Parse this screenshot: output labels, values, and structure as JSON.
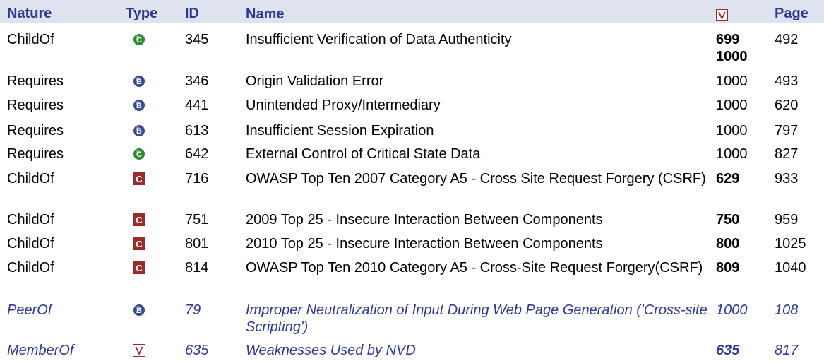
{
  "header": {
    "nature": "Nature",
    "type": "Type",
    "id": "ID",
    "name": "Name",
    "view_icon": "view-icon",
    "page": "Page"
  },
  "rows": [
    {
      "nature": "ChildOf",
      "type_icon": "compound-icon",
      "id": "345",
      "name": "Insufficient Verification of Data Authenticity",
      "view": "699",
      "view2": "1000",
      "page": "492",
      "view_bold": true
    },
    {
      "nature": "Requires",
      "type_icon": "base-icon",
      "id": "346",
      "name": "Origin Validation Error",
      "view": "1000",
      "view2": "",
      "page": "493",
      "view_bold": false
    },
    {
      "nature": "Requires",
      "type_icon": "base-icon",
      "id": "441",
      "name": "Unintended Proxy/Intermediary",
      "view": "1000",
      "view2": "",
      "page": "620",
      "view_bold": false
    },
    {
      "nature": "Requires",
      "type_icon": "base-icon",
      "id": "613",
      "name": "Insufficient Session Expiration",
      "view": "1000",
      "view2": "",
      "page": "797",
      "view_bold": false
    },
    {
      "nature": "Requires",
      "type_icon": "compound-icon",
      "id": "642",
      "name": "External Control of Critical State Data",
      "view": "1000",
      "view2": "",
      "page": "827",
      "view_bold": false
    },
    {
      "nature": "ChildOf",
      "type_icon": "category-icon",
      "id": "716",
      "name": "OWASP Top Ten 2007 Category A5 - Cross Site Request Forgery (CSRF)",
      "view": "629",
      "view2": "",
      "page": "933",
      "view_bold": true
    },
    {
      "nature": "ChildOf",
      "type_icon": "category-icon",
      "id": "751",
      "name": "2009 Top 25 - Insecure Interaction Between Components",
      "view": "750",
      "view2": "",
      "page": "959",
      "view_bold": true
    },
    {
      "nature": "ChildOf",
      "type_icon": "category-icon",
      "id": "801",
      "name": "2010 Top 25 - Insecure Interaction Between Components",
      "view": "800",
      "view2": "",
      "page": "1025",
      "view_bold": true
    },
    {
      "nature": "ChildOf",
      "type_icon": "category-icon",
      "id": "814",
      "name": "OWASP Top Ten 2010 Category A5 - Cross-Site Request Forgery(CSRF)",
      "view": "809",
      "view2": "",
      "page": "1040",
      "view_bold": true
    },
    {
      "nature": "PeerOf",
      "type_icon": "base-icon",
      "id": "79",
      "name": "Improper Neutralization of Input During Web Page Generation ('Cross-site Scripting')",
      "view": "1000",
      "view2": "",
      "page": "108",
      "view_bold": false
    },
    {
      "nature": "MemberOf",
      "type_icon": "view-icon",
      "id": "635",
      "name": "Weaknesses Used by NVD",
      "view": "635",
      "view2": "",
      "page": "817",
      "view_bold": true
    }
  ],
  "colors": {
    "header_bg": "#dfe3f0",
    "header_text": "#2f3a8f",
    "compound_green": "#2e8b2e",
    "base_blue": "#3b4a8c",
    "category_red": "#9a2b2b"
  }
}
